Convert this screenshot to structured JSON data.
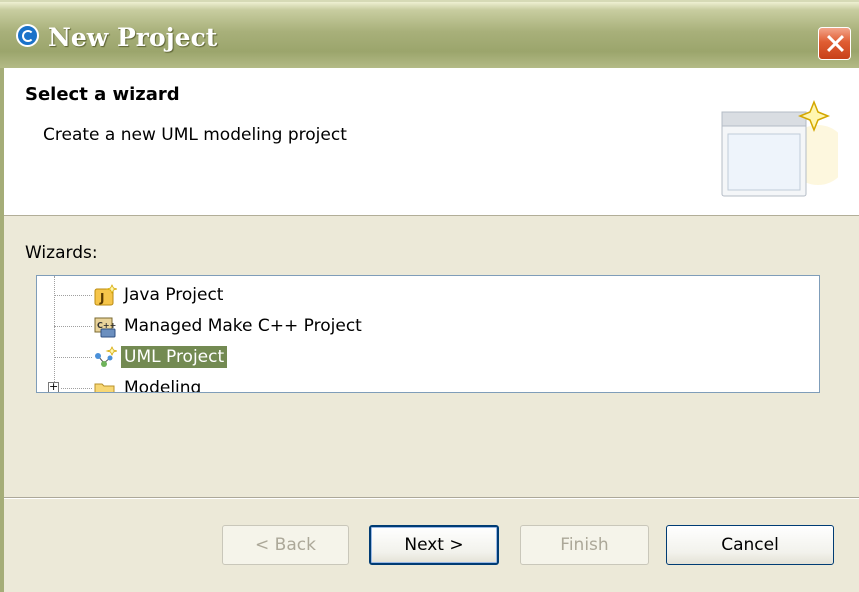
{
  "window": {
    "title": "New Project",
    "close_icon": "close-icon"
  },
  "header": {
    "title": "Select a wizard",
    "description": "Create a new UML modeling project",
    "banner_icon": "new-wizard-banner-icon"
  },
  "wizards": {
    "label": "Wizards:",
    "items": [
      {
        "label": "Java Project",
        "icon": "java-project-icon"
      },
      {
        "label": "Managed Make C++ Project",
        "icon": "cpp-project-icon"
      },
      {
        "label": "UML Project",
        "icon": "uml-project-icon",
        "selected": true
      },
      {
        "label": "Modeling",
        "icon": "folder-icon",
        "expandable": true
      }
    ]
  },
  "buttons": {
    "back": "< Back",
    "next": "Next >",
    "finish": "Finish",
    "cancel": "Cancel"
  },
  "colors": {
    "titlebar": "#a8b07a",
    "selection": "#738a52",
    "dialog_bg": "#ece9d8"
  }
}
